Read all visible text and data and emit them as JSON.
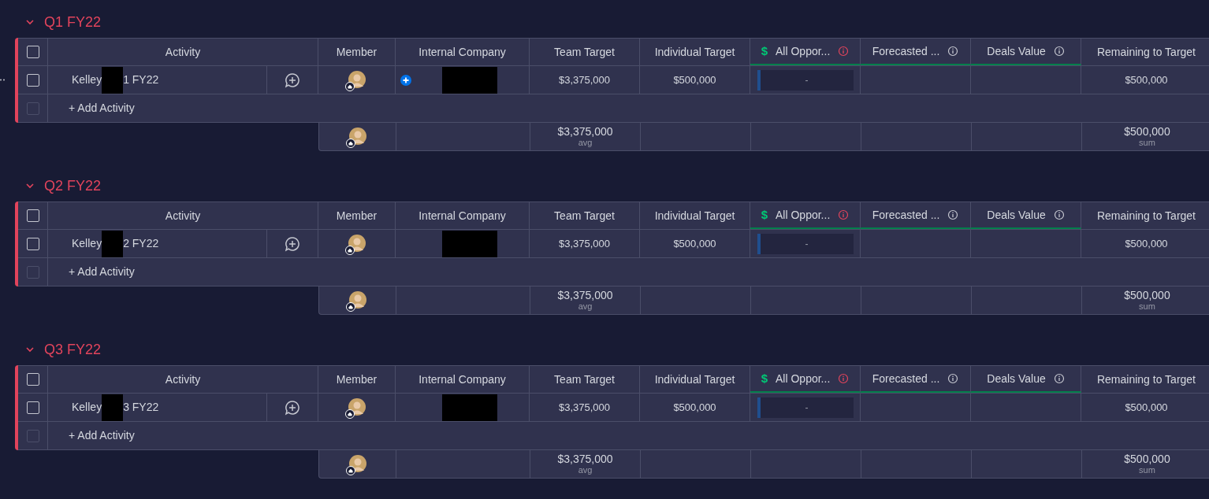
{
  "groups": [
    {
      "title": "Q1 FY22",
      "expanded": true,
      "all_checked": false,
      "add_checked": false,
      "opportunity_icon": "$",
      "columns": [
        "Activity",
        "Member",
        "Internal Company",
        "Team Target",
        "Individual Target",
        "All Oppor...",
        "Forecasted ...",
        "Deals Value",
        "Remaining to Target"
      ],
      "rows": [
        {
          "name_start": "Kelley",
          "name_end": "1 FY22",
          "checked": false,
          "hovered": true,
          "team_target": "$3,375,000",
          "individual_target": "$500,000",
          "all_opportunities": "-",
          "remaining": "$500,000"
        }
      ],
      "add_label": "+ Add Activity",
      "summary": {
        "team_target": "$3,375,000",
        "team_target_fn": "avg",
        "remaining": "$500,000",
        "remaining_fn": "sum"
      }
    },
    {
      "title": "Q2 FY22",
      "expanded": true,
      "all_checked": false,
      "add_checked": false,
      "opportunity_icon": "$",
      "columns": [
        "Activity",
        "Member",
        "Internal Company",
        "Team Target",
        "Individual Target",
        "All Oppor...",
        "Forecasted ...",
        "Deals Value",
        "Remaining to Target"
      ],
      "rows": [
        {
          "name_start": "Kelley",
          "name_end": "2 FY22",
          "checked": false,
          "hovered": false,
          "team_target": "$3,375,000",
          "individual_target": "$500,000",
          "all_opportunities": "-",
          "remaining": "$500,000"
        }
      ],
      "add_label": "+ Add Activity",
      "summary": {
        "team_target": "$3,375,000",
        "team_target_fn": "avg",
        "remaining": "$500,000",
        "remaining_fn": "sum"
      }
    },
    {
      "title": "Q3 FY22",
      "expanded": true,
      "all_checked": false,
      "add_checked": false,
      "opportunity_icon": "$",
      "columns": [
        "Activity",
        "Member",
        "Internal Company",
        "Team Target",
        "Individual Target",
        "All Oppor...",
        "Forecasted ...",
        "Deals Value",
        "Remaining to Target"
      ],
      "rows": [
        {
          "name_start": "Kelley",
          "name_end": "3 FY22",
          "checked": false,
          "hovered": false,
          "team_target": "$3,375,000",
          "individual_target": "$500,000",
          "all_opportunities": "-",
          "remaining": "$500,000"
        }
      ],
      "add_label": "+ Add Activity",
      "summary": {
        "team_target": "$3,375,000",
        "team_target_fn": "avg",
        "remaining": "$500,000",
        "remaining_fn": "sum"
      }
    }
  ]
}
